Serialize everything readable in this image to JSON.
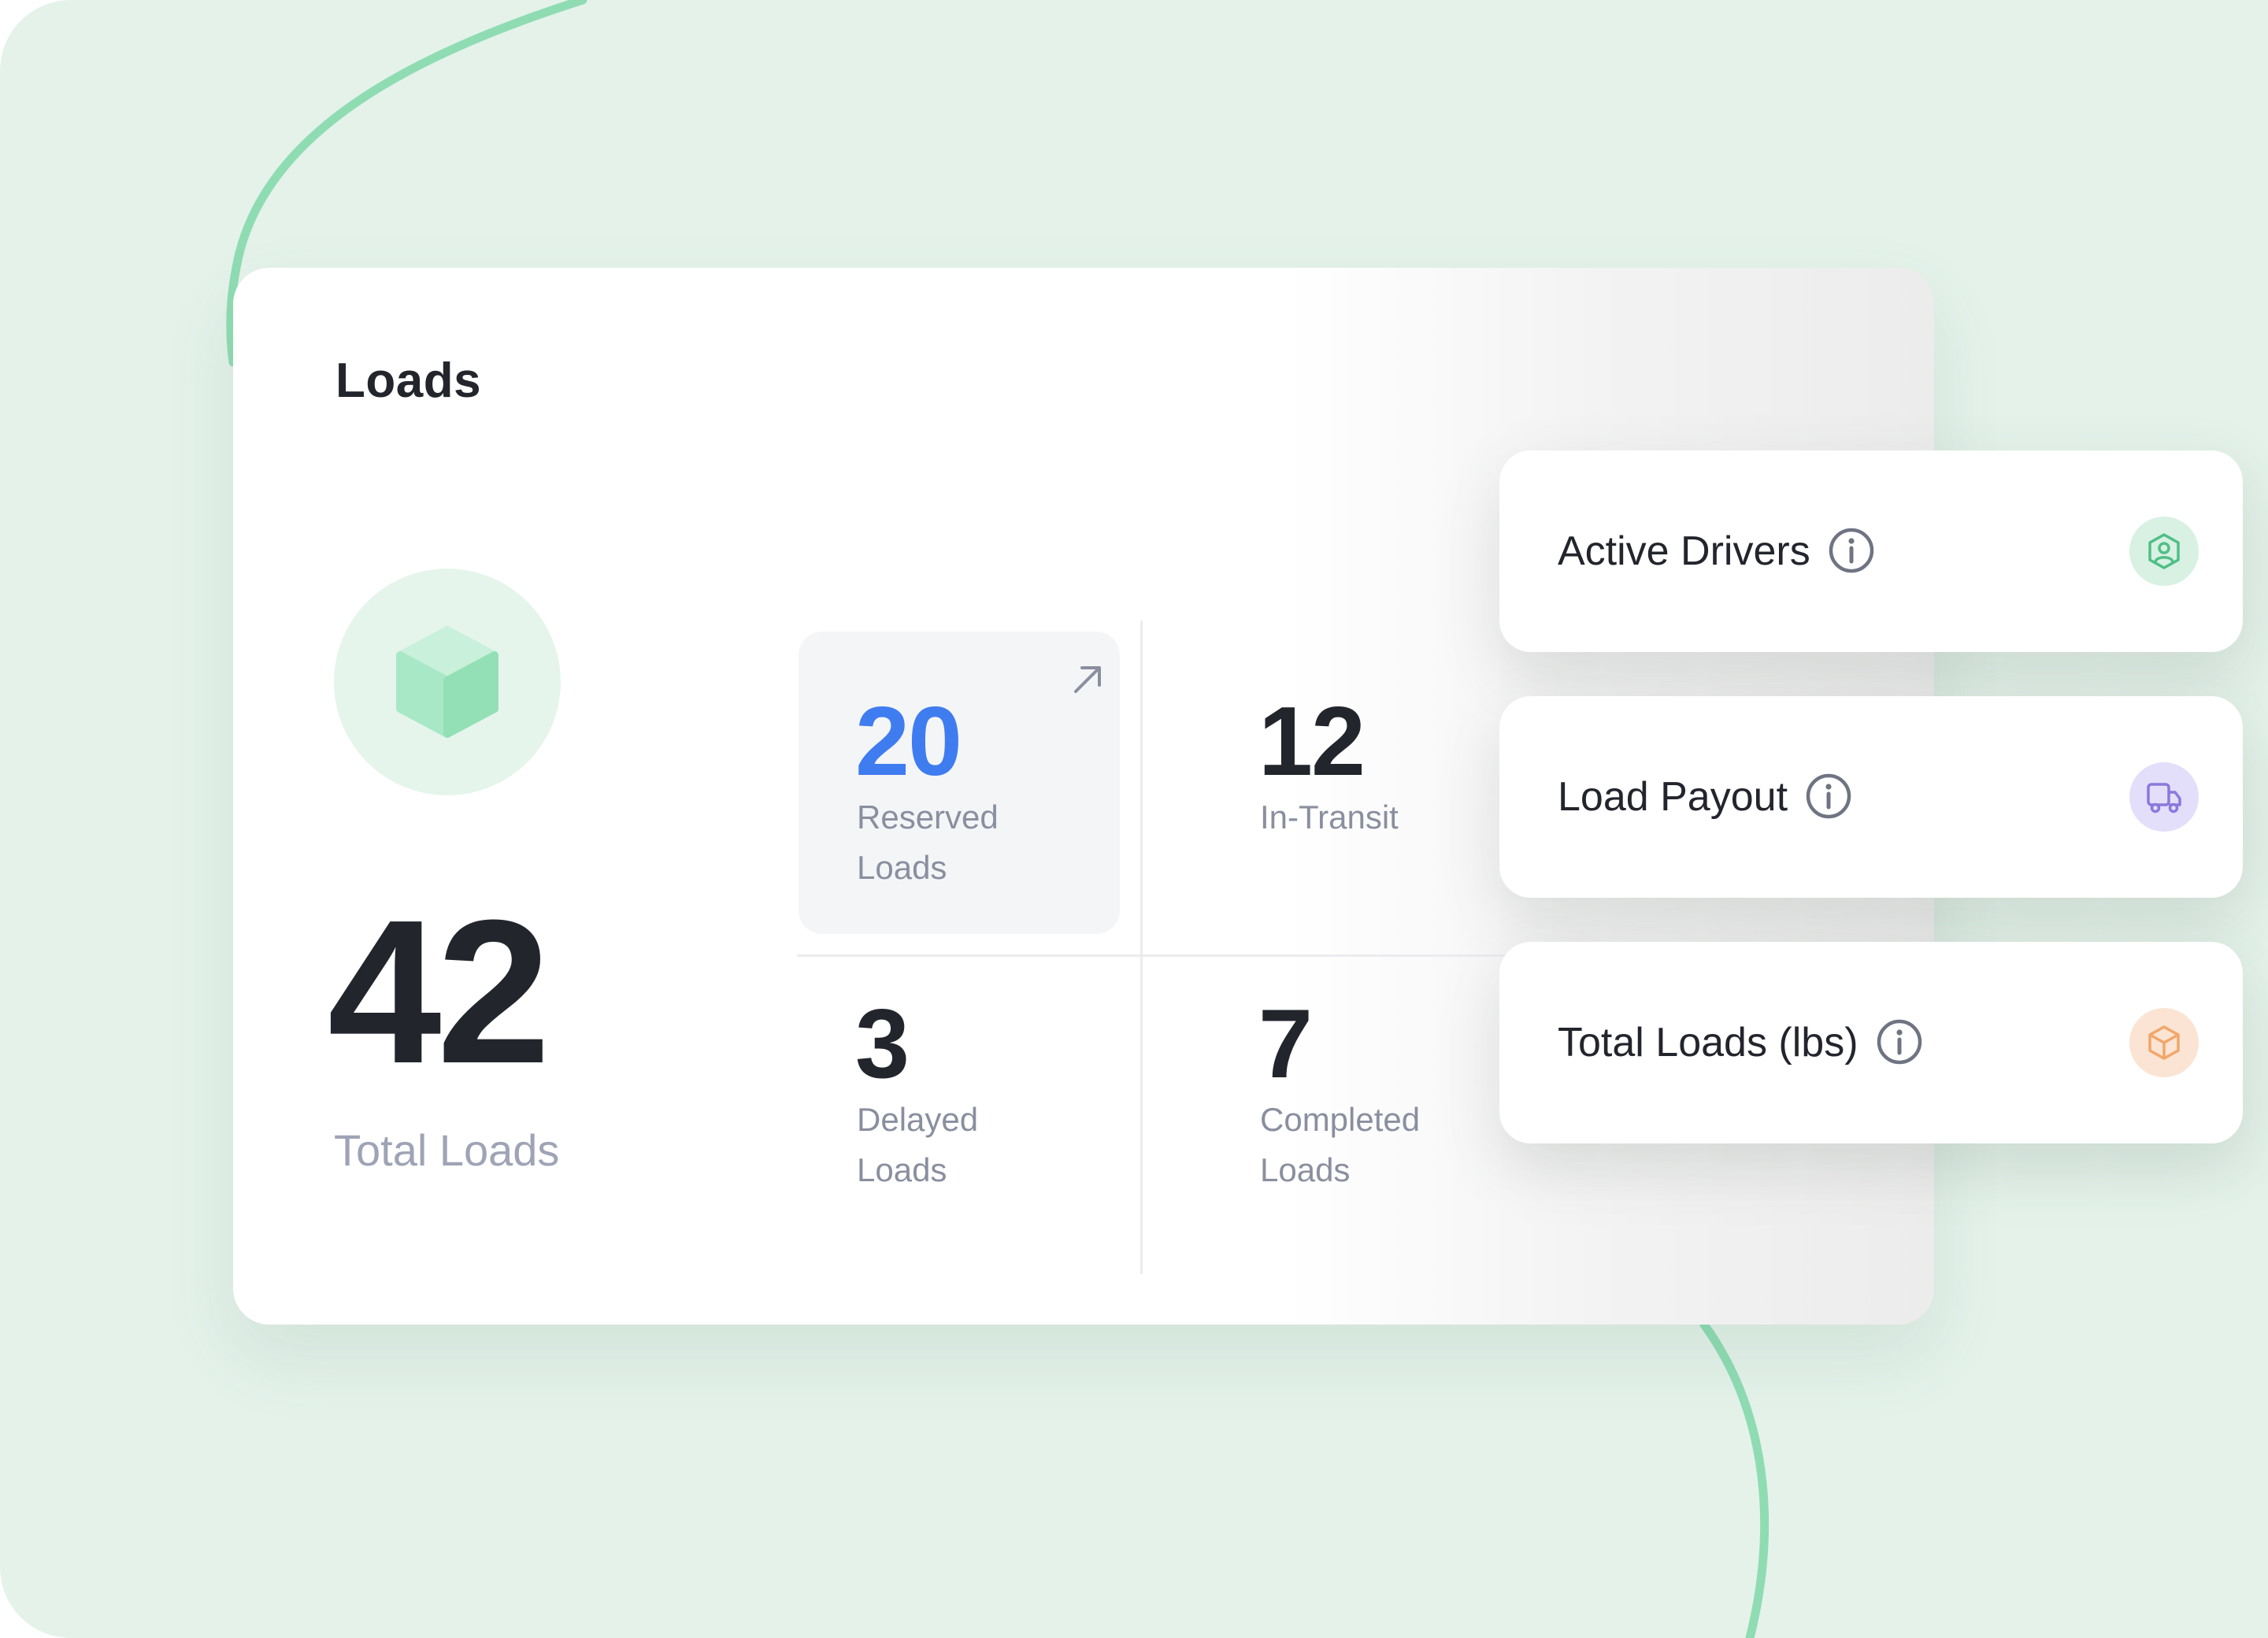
{
  "card": {
    "title": "Loads",
    "total": {
      "value": "42",
      "label": "Total Loads",
      "icon": "box-3d-icon"
    },
    "stats": [
      {
        "value": "20",
        "label": "Reserved\nLoads",
        "highlighted": true,
        "action_icon": "arrow-up-right-icon",
        "value_color": "#3f7cf0"
      },
      {
        "value": "12",
        "label": "In-Transit"
      },
      {
        "value": "3",
        "label": "Delayed\nLoads"
      },
      {
        "value": "7",
        "label": "Completed\nLoads"
      }
    ]
  },
  "metric_cards": [
    {
      "label": "Active Drivers",
      "info_icon": "info-icon",
      "badge_icon": "driver-shield-icon",
      "badge_color": "#d8f1e3",
      "icon_color": "#4fbf86"
    },
    {
      "label": "Load Payout",
      "info_icon": "info-icon",
      "badge_icon": "truck-icon",
      "badge_color": "#e3defa",
      "icon_color": "#8b78db"
    },
    {
      "label": "Total Loads (lbs)",
      "info_icon": "info-icon",
      "badge_icon": "package-icon",
      "badge_color": "#fbe4d3",
      "icon_color": "#f2a66a"
    }
  ],
  "colors": {
    "background": "#e4f2ea",
    "accent_curve": "#8fdcb3",
    "text_dark": "#23252d",
    "text_muted": "#8a8f9f"
  }
}
